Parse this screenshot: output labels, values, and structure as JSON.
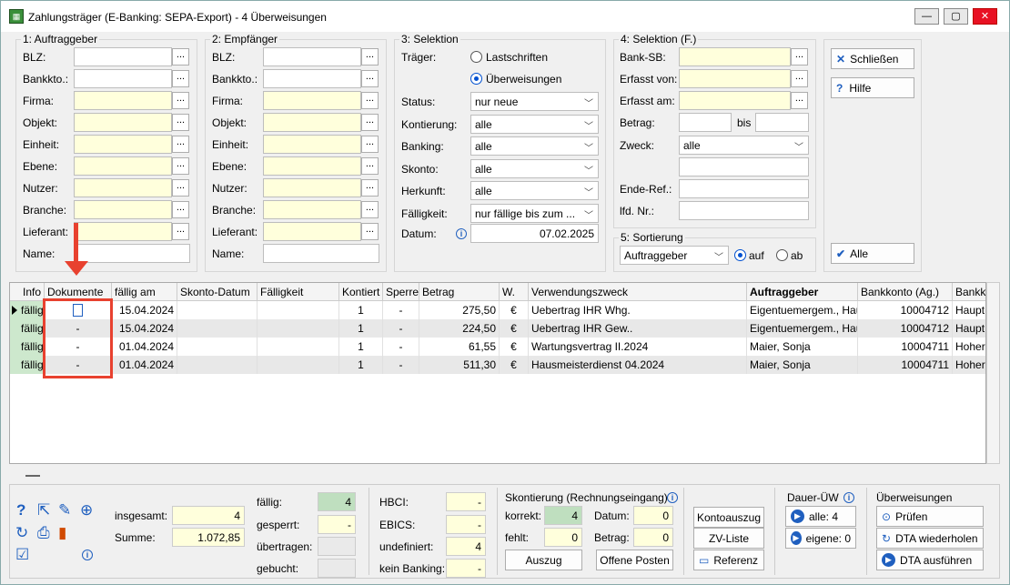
{
  "window": {
    "title": "Zahlungsträger (E-Banking: SEPA-Export) - 4 Überweisungen",
    "min": "—",
    "max": "▢",
    "close": "✕"
  },
  "auftraggeber": {
    "title": "1: Auftraggeber",
    "fields": [
      {
        "label": "BLZ:",
        "value": ""
      },
      {
        "label": "Bankkto.:",
        "value": ""
      },
      {
        "label": "Firma:",
        "value": ""
      },
      {
        "label": "Objekt:",
        "value": ""
      },
      {
        "label": "Einheit:",
        "value": ""
      },
      {
        "label": "Ebene:",
        "value": ""
      },
      {
        "label": "Nutzer:",
        "value": ""
      },
      {
        "label": "Branche:",
        "value": ""
      },
      {
        "label": "Lieferant:",
        "value": ""
      },
      {
        "label": "Name:",
        "value": ""
      }
    ]
  },
  "empfaenger": {
    "title": "2: Empfänger",
    "fields": [
      {
        "label": "BLZ:",
        "value": ""
      },
      {
        "label": "Bankkto.:",
        "value": ""
      },
      {
        "label": "Firma:",
        "value": ""
      },
      {
        "label": "Objekt:",
        "value": ""
      },
      {
        "label": "Einheit:",
        "value": ""
      },
      {
        "label": "Ebene:",
        "value": ""
      },
      {
        "label": "Nutzer:",
        "value": ""
      },
      {
        "label": "Branche:",
        "value": ""
      },
      {
        "label": "Lieferant:",
        "value": ""
      },
      {
        "label": "Name:",
        "value": ""
      }
    ]
  },
  "selektion": {
    "title": "3: Selektion",
    "traeger_label": "Träger:",
    "radio_lastschriften": "Lastschriften",
    "radio_ueberweisungen": "Überweisungen",
    "rows": [
      {
        "label": "Status:",
        "value": "nur neue"
      },
      {
        "label": "Kontierung:",
        "value": "alle"
      },
      {
        "label": "Banking:",
        "value": "alle"
      },
      {
        "label": "Skonto:",
        "value": "alle"
      },
      {
        "label": "Herkunft:",
        "value": "alle"
      },
      {
        "label": "Fälligkeit:",
        "value": "nur fällige bis zum ..."
      }
    ],
    "datum_label": "Datum:",
    "datum_value": "07.02.2025"
  },
  "selektion_f": {
    "title": "4: Selektion (F.)",
    "bank_sb": "Bank-SB:",
    "erfasst_von": "Erfasst von:",
    "erfasst_am": "Erfasst am:",
    "betrag": "Betrag:",
    "bis": "bis",
    "zweck": "Zweck:",
    "zweck_value": "alle",
    "ende_ref": "Ende-Ref.:",
    "lfd_nr": "lfd. Nr.:"
  },
  "sortierung": {
    "title": "5: Sortierung",
    "value": "Auftraggeber",
    "auf": "auf",
    "ab": "ab"
  },
  "buttons": {
    "schliessen": "Schließen",
    "hilfe": "Hilfe",
    "alle": "Alle",
    "dots": "..."
  },
  "table": {
    "columns": [
      "Info",
      "Dokumente",
      "fällig am",
      "Skonto-Datum",
      "Fälligkeit",
      "Kontiert",
      "Sperre",
      "Betrag",
      "W.",
      "Verwendungszweck",
      "Auftraggeber",
      "Bankkonto (Ag.)",
      "Bankk"
    ],
    "rows": [
      {
        "info": "fällig",
        "dok": "",
        "faellig": "15.04.2024",
        "skonto": "",
        "faelligkeit": "",
        "kontiert": "1",
        "sperre": "-",
        "betrag": "275,50",
        "w": "€",
        "zweck": "Uebertrag IHR Whg.",
        "ag": "Eigentuemergem., Haupt",
        "konto": "10004712",
        "bank": "Haupt"
      },
      {
        "info": "fällig",
        "dok": "-",
        "faellig": "15.04.2024",
        "skonto": "",
        "faelligkeit": "",
        "kontiert": "1",
        "sperre": "-",
        "betrag": "224,50",
        "w": "€",
        "zweck": "Uebertrag IHR Gew..",
        "ag": "Eigentuemergem., Haupt",
        "konto": "10004712",
        "bank": "Haupt"
      },
      {
        "info": "fällig",
        "dok": "-",
        "faellig": "01.04.2024",
        "skonto": "",
        "faelligkeit": "",
        "kontiert": "1",
        "sperre": "-",
        "betrag": "61,55",
        "w": "€",
        "zweck": "Wartungsvertrag II.2024",
        "ag": "Maier, Sonja",
        "konto": "10004711",
        "bank": "Hoher"
      },
      {
        "info": "fällig",
        "dok": "-",
        "faellig": "01.04.2024",
        "skonto": "",
        "faelligkeit": "",
        "kontiert": "1",
        "sperre": "-",
        "betrag": "511,30",
        "w": "€",
        "zweck": "Hausmeisterdienst 04.2024",
        "ag": "Maier, Sonja",
        "konto": "10004711",
        "bank": "Hoher"
      }
    ]
  },
  "summary": {
    "insgesamt_label": "insgesamt:",
    "insgesamt": "4",
    "summe_label": "Summe:",
    "summe": "1.072,85",
    "faellig_label": "fällig:",
    "faellig": "4",
    "gesperrt_label": "gesperrt:",
    "gesperrt": "-",
    "uebertragen_label": "übertragen:",
    "uebertragen": "",
    "gebucht_label": "gebucht:",
    "gebucht": "",
    "hbci_label": "HBCI:",
    "hbci": "-",
    "ebics_label": "EBICS:",
    "ebics": "-",
    "undefiniert_label": "undefiniert:",
    "undefiniert": "4",
    "keinbanking_label": "kein Banking:",
    "keinbanking": "-"
  },
  "skonto": {
    "title": "Skontierung (Rechnungseingang)",
    "korrekt_label": "korrekt:",
    "korrekt": "4",
    "fehlt_label": "fehlt:",
    "fehlt": "0",
    "datum_label": "Datum:",
    "datum": "0",
    "betrag_label": "Betrag:",
    "betrag": "0",
    "auszug": "Auszug",
    "offene": "Offene Posten"
  },
  "mid_buttons": {
    "kontoauszug": "Kontoauszug",
    "zvliste": "ZV-Liste",
    "referenz": "Referenz"
  },
  "dauer": {
    "title": "Dauer-ÜW",
    "alle": "alle: 4",
    "eigene": "eigene: 0"
  },
  "ueberweisungen": {
    "title": "Überweisungen",
    "pruefen": "Prüfen",
    "dta_wiederholen": "DTA wiederholen",
    "dta_ausfuehren": "DTA ausführen"
  },
  "colors": {
    "highlight": "#ffffdc",
    "green": "#bfdfbf",
    "accent": "#1f5fbf",
    "annotation": "#e8412f"
  }
}
